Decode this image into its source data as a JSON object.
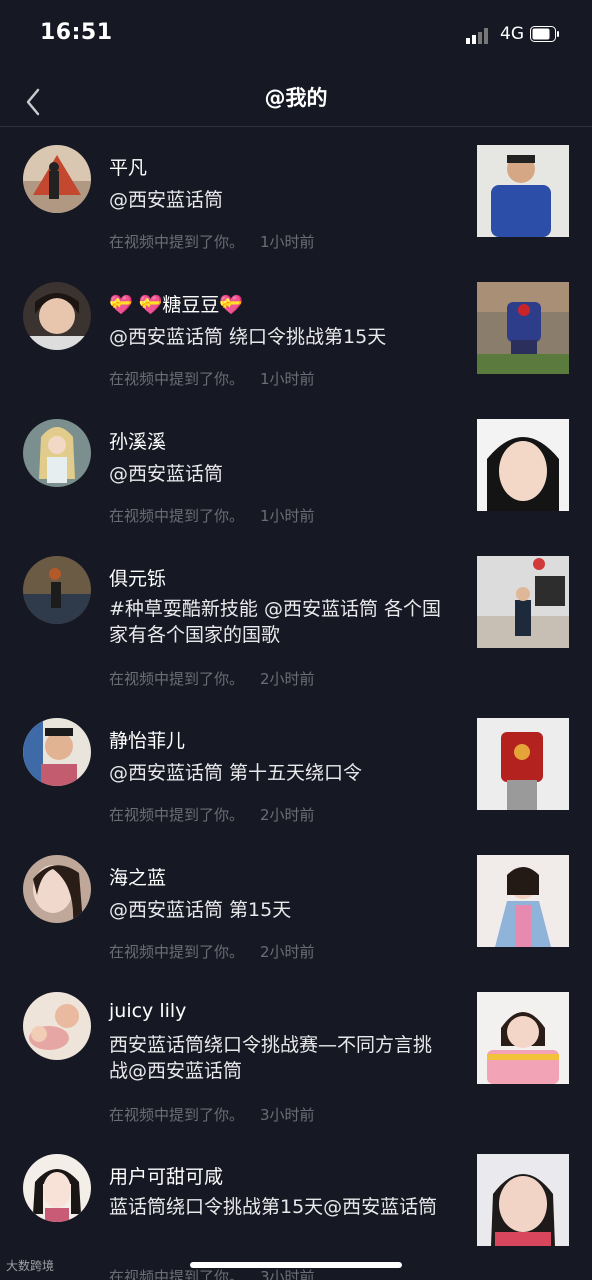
{
  "status": {
    "time": "16:51",
    "network": "4G"
  },
  "nav": {
    "title": "@我的"
  },
  "meta_label": "在视频中提到了你。",
  "items": [
    {
      "name": "平凡",
      "content": "@西安蓝话筒",
      "meta": "在视频中提到了你。",
      "ago": "1小时前"
    },
    {
      "name": "💝 💝糖豆豆💝",
      "content": "@西安蓝话筒 绕口令挑战第15天",
      "meta": "在视频中提到了你。",
      "ago": "1小时前"
    },
    {
      "name": "孙溪溪",
      "content": "@西安蓝话筒",
      "meta": "在视频中提到了你。",
      "ago": "1小时前"
    },
    {
      "name": "俱元铄",
      "content": "#种草耍酷新技能 @西安蓝话筒 各个国家有各个国家的国歌",
      "meta": "在视频中提到了你。",
      "ago": "2小时前"
    },
    {
      "name": "静怡菲儿",
      "content": "@西安蓝话筒 第十五天绕口令",
      "meta": "在视频中提到了你。",
      "ago": "2小时前"
    },
    {
      "name": "海之蓝",
      "content": "@西安蓝话筒 第15天",
      "meta": "在视频中提到了你。",
      "ago": "2小时前"
    },
    {
      "name": "juicy  lily",
      "content": "西安蓝话筒绕口令挑战赛—不同方言挑战@西安蓝话筒",
      "meta": "在视频中提到了你。",
      "ago": "3小时前"
    },
    {
      "name": "用户可甜可咸",
      "content": "蓝话筒绕口令挑战第15天@西安蓝话筒",
      "meta": "在视频中提到了你。",
      "ago": "3小时前"
    }
  ],
  "watermark": "大数跨境",
  "colors": {
    "background": "#161823",
    "meta": "#6c6d74",
    "divider": "#2e303b"
  }
}
